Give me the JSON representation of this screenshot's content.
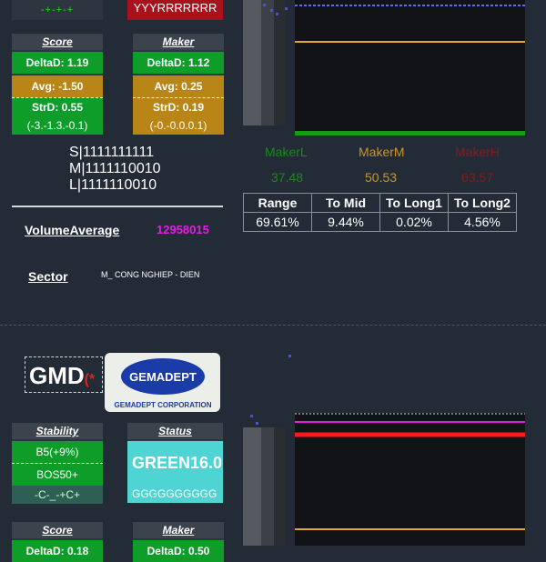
{
  "top_stability_badge": {
    "value": "-+-+-+"
  },
  "top_status_badge": {
    "value": "YYYRRRRRRR"
  },
  "score_card": {
    "title": "Score",
    "delta": "DeltaD: 1.19",
    "avg": "Avg: -1.50",
    "strd": "StrD: 0.55",
    "range": "(-3.-1.3.-0.1)"
  },
  "maker_card": {
    "title": "Maker",
    "delta": "DeltaD: 1.12",
    "avg": "Avg: 0.25",
    "strd": "StrD: 0.19",
    "range": "(-0.-0.0.0.1)"
  },
  "slm": {
    "s": "S|1111111111",
    "m": "M|1111110010",
    "l": "L|1111110010"
  },
  "volume": {
    "label": "VolumeAverage",
    "value": "12958015"
  },
  "sector": {
    "label": "Sector",
    "value": "M_ CONG NGHIEP - DIEN"
  },
  "makers": {
    "low": {
      "label": "MakerL",
      "value": "37.48",
      "color": "#1a8a1a"
    },
    "mid": {
      "label": "MakerM",
      "value": "50.53",
      "color": "#c9962a"
    },
    "high": {
      "label": "MakerH",
      "value": "63.57",
      "color": "#8b1a1a"
    }
  },
  "metrics_table": {
    "headers": [
      "Range",
      "To Mid",
      "To Long1",
      "To Long2"
    ],
    "values": [
      "69.61%",
      "9.44%",
      "0.02%",
      "4.56%"
    ]
  },
  "ticker2": {
    "symbol": "GMD",
    "marker": "(*",
    "logo_text": "GEMADEPT",
    "logo_subtitle": "GEMADEPT CORPORATION"
  },
  "stability_card": {
    "title": "Stability",
    "row1": "B5(+9%)",
    "row2": "BOS50+",
    "row3": "-C-_-+C+"
  },
  "status_card": {
    "title": "Status",
    "value": "GREEN16.0",
    "sub": "GGGGGGGGGG"
  },
  "score_card2": {
    "title": "Score",
    "delta": "DeltaD: 0.18"
  },
  "maker_card2": {
    "title": "Maker",
    "delta": "DeltaD: 0.50"
  },
  "colors": {
    "background": "#222b36",
    "green": "#0f9d2a",
    "gold": "#b88516",
    "magenta": "#e020e0",
    "cyan": "#4fd4d4",
    "red": "#ff1a1a"
  }
}
